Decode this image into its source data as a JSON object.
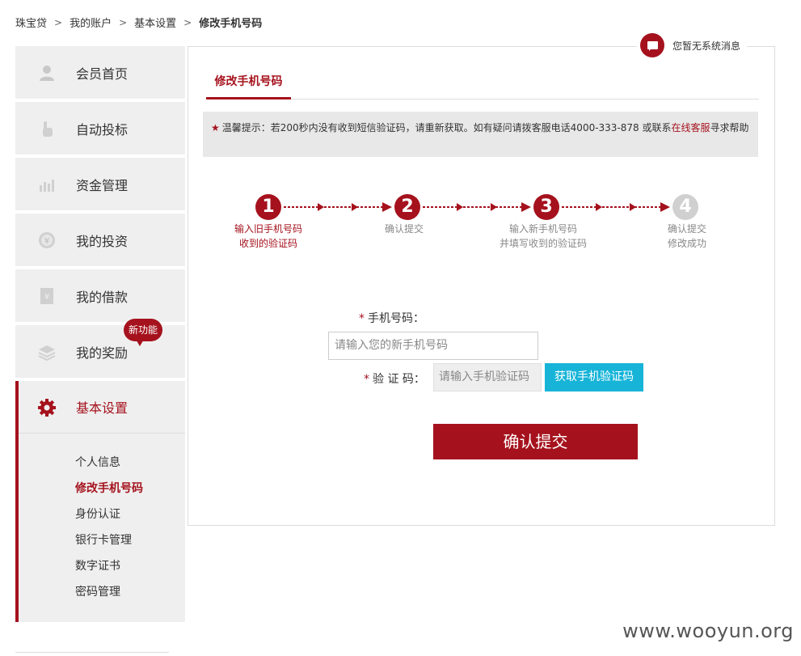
{
  "breadcrumb": {
    "items": [
      "珠宝贷",
      "我的账户",
      "基本设置"
    ],
    "current": "修改手机号码",
    "separator": ">"
  },
  "sidebar": {
    "items": [
      {
        "label": "会员首页",
        "icon": "user-icon"
      },
      {
        "label": "自动投标",
        "icon": "hand-pointer-icon"
      },
      {
        "label": "资金管理",
        "icon": "chart-icon"
      },
      {
        "label": "我的投资",
        "icon": "yen-coin-icon"
      },
      {
        "label": "我的借款",
        "icon": "yen-document-icon"
      },
      {
        "label": "我的奖励",
        "icon": "layers-icon",
        "badge": "新功能"
      }
    ],
    "active": {
      "label": "基本设置",
      "icon": "gear-icon",
      "submenu": [
        "个人信息",
        "修改手机号码",
        "身份认证",
        "银行卡管理",
        "数字证书",
        "密码管理"
      ],
      "selected_index": 1
    }
  },
  "notification": {
    "text": "您暂无系统消息",
    "icon": "message-icon"
  },
  "main": {
    "tab": "修改手机号码",
    "tip": {
      "star": "★",
      "text_before": "温馨提示：若200秒内没有收到短信验证码，请重新获取。如有疑问请拨客服电话4000-333-878 或联系",
      "link": "在线客服",
      "text_after": "寻求帮助"
    },
    "steps": [
      {
        "num": "1",
        "line1": "输入旧手机号码",
        "line2": "收到的验证码",
        "state": "done"
      },
      {
        "num": "2",
        "line1": "确认提交",
        "line2": "",
        "state": "done"
      },
      {
        "num": "3",
        "line1": "输入新手机号码",
        "line2": "并填写收到的验证码",
        "state": "current"
      },
      {
        "num": "4",
        "line1": "确认提交",
        "line2": "修改成功",
        "state": "pending"
      }
    ],
    "form": {
      "required_mark": "*",
      "phone_label": "手机号码：",
      "phone_placeholder": "请输入您的新手机号码",
      "code_label": "验 证 码：",
      "code_placeholder": "请输入手机验证码",
      "code_button": "获取手机验证码",
      "submit": "确认提交"
    }
  },
  "watermark": "www.wooyun.org",
  "colors": {
    "accent": "#a5121d",
    "button_blue": "#17b4d8",
    "sidebar_bg": "#efefef"
  }
}
